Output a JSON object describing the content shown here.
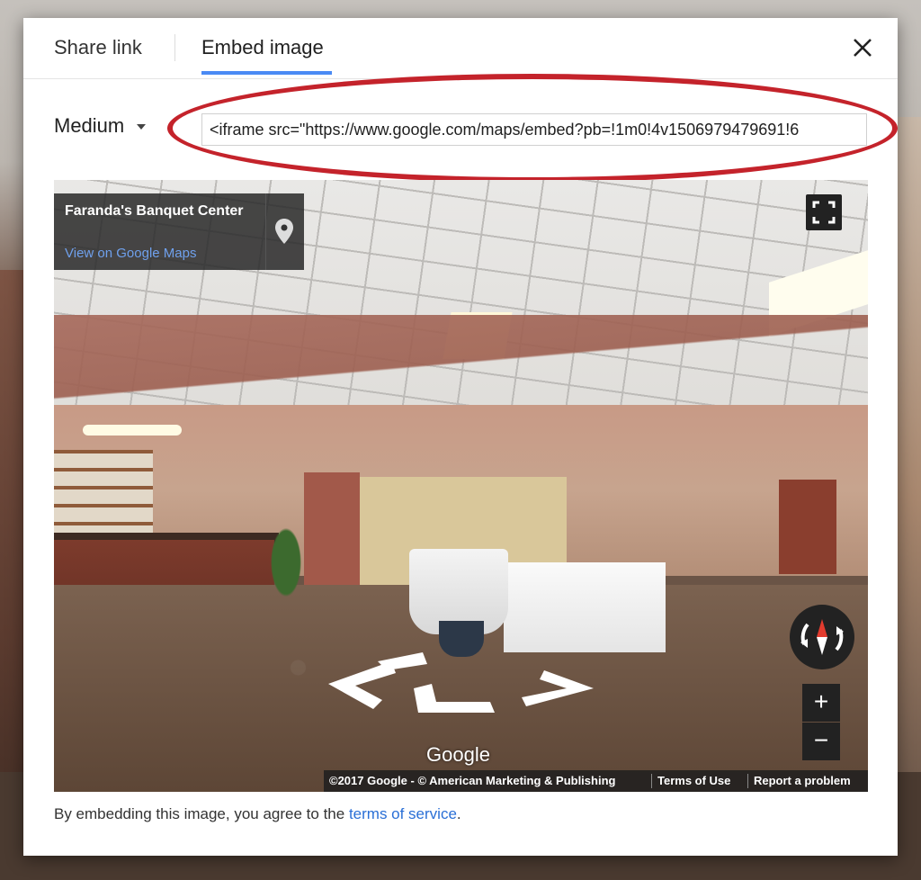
{
  "tabs": [
    {
      "label": "Share link",
      "active": false
    },
    {
      "label": "Embed image",
      "active": true
    }
  ],
  "close": {
    "icon": "close-icon"
  },
  "size_select": {
    "selected": "Medium"
  },
  "embed_code": {
    "value": "<iframe src=\"https://www.google.com/maps/embed?pb=!1m0!4v1506979479691!6"
  },
  "preview": {
    "place": {
      "title": "Faranda's Banquet Center",
      "link": "View on Google Maps"
    },
    "attribution": "Google",
    "footer": {
      "copyright": "©2017 Google - © American Marketing & Publishing",
      "terms": "Terms of Use",
      "report": "Report a problem"
    },
    "zoom": {
      "in": "+",
      "out": "−"
    }
  },
  "legal": {
    "prefix": "By embedding this image, you agree to the ",
    "link": "terms of service",
    "suffix": "."
  },
  "colors": {
    "accent": "#4a8af4",
    "highlight_ring": "#c4232b",
    "link": "#2a6fd6"
  }
}
